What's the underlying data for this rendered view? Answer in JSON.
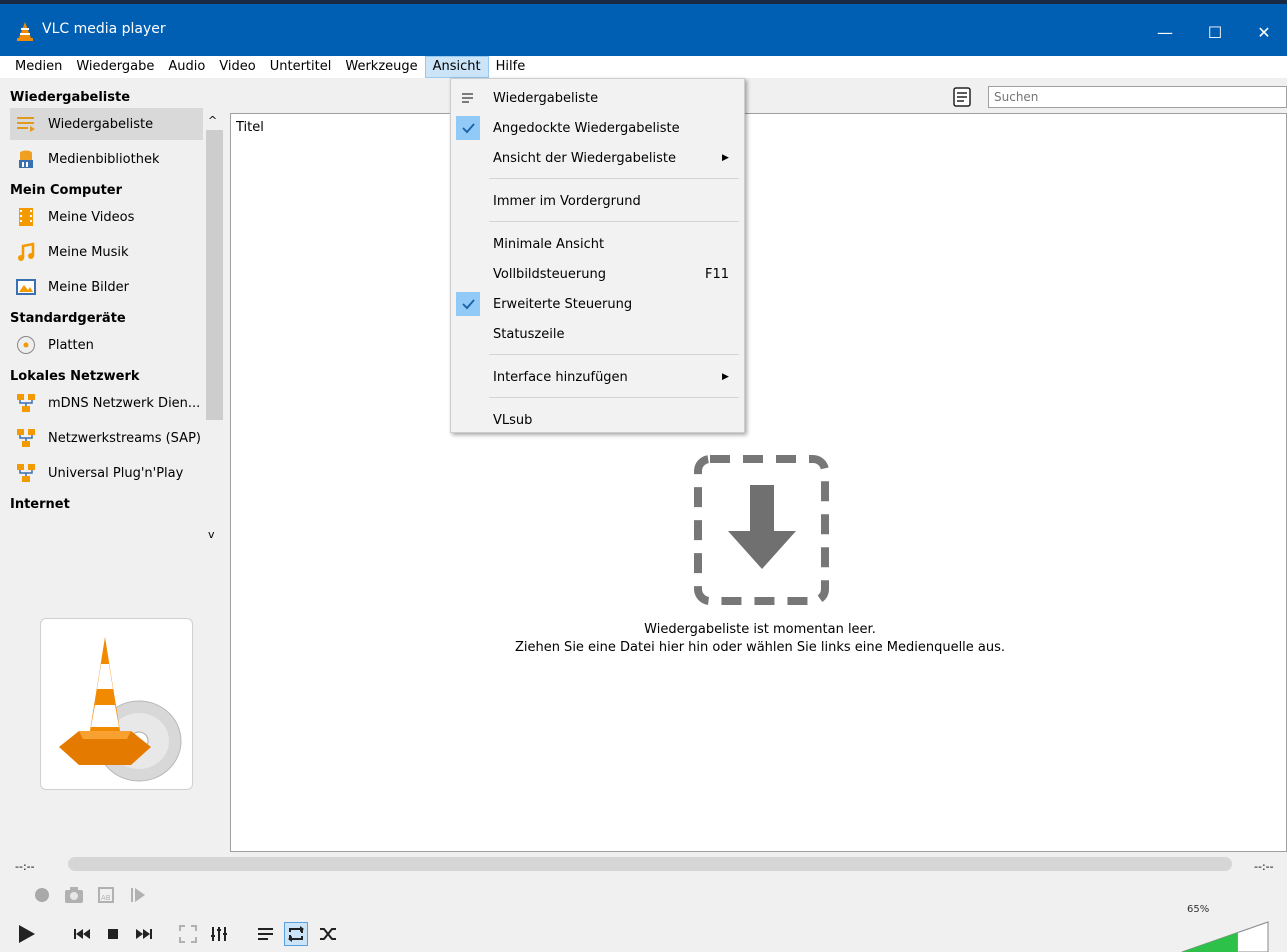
{
  "window": {
    "title": "VLC media player",
    "controls": {
      "minimize": "—",
      "maximize": "☐",
      "close": "✕"
    }
  },
  "menubar": [
    "Medien",
    "Wiedergabe",
    "Audio",
    "Video",
    "Untertitel",
    "Werkzeuge",
    "Ansicht",
    "Hilfe"
  ],
  "sidebar": {
    "sections": [
      {
        "heading": "Wiedergabeliste",
        "items": [
          {
            "label": "Wiedergabeliste",
            "icon": "playlist-icon",
            "selected": true
          },
          {
            "label": "Medienbibliothek",
            "icon": "media-library-icon"
          }
        ]
      },
      {
        "heading": "Mein Computer",
        "items": [
          {
            "label": "Meine Videos",
            "icon": "video-film-icon"
          },
          {
            "label": "Meine Musik",
            "icon": "music-note-icon"
          },
          {
            "label": "Meine Bilder",
            "icon": "picture-icon"
          }
        ]
      },
      {
        "heading": "Standardgeräte",
        "items": [
          {
            "label": "Platten",
            "icon": "disc-icon"
          }
        ]
      },
      {
        "heading": "Lokales Netzwerk",
        "items": [
          {
            "label": "mDNS Netzwerk Dien...",
            "icon": "network-icon"
          },
          {
            "label": "Netzwerkstreams (SAP)",
            "icon": "network-icon"
          },
          {
            "label": "Universal Plug'n'Play",
            "icon": "network-icon"
          }
        ]
      },
      {
        "heading": "Internet",
        "items": []
      }
    ]
  },
  "playlist": {
    "search_placeholder": "Suchen",
    "column_title": "Titel",
    "empty_line1": "Wiedergabeliste ist momentan leer.",
    "empty_line2": "Ziehen Sie eine Datei hier hin oder wählen Sie links eine Medienquelle aus."
  },
  "dropdown": {
    "groups": [
      [
        {
          "label": "Wiedergabeliste",
          "icon": "playlist-icon"
        },
        {
          "label": "Angedockte Wiedergabeliste",
          "checked": true
        },
        {
          "label": "Ansicht der Wiedergabeliste",
          "submenu": true
        }
      ],
      [
        {
          "label": "Immer im Vordergrund"
        }
      ],
      [
        {
          "label": "Minimale Ansicht"
        },
        {
          "label": "Vollbildsteuerung",
          "shortcut": "F11"
        },
        {
          "label": "Erweiterte Steuerung",
          "checked": true
        },
        {
          "label": "Statuszeile"
        }
      ],
      [
        {
          "label": "Interface hinzufügen",
          "submenu": true
        }
      ],
      [
        {
          "label": "VLsub"
        }
      ]
    ]
  },
  "player": {
    "time_elapsed": "--:--",
    "time_total": "--:--",
    "volume_percent": 65,
    "volume_label": "65%",
    "loop_checked": true
  },
  "colors": {
    "titlebar": "#005fb3",
    "selection": "#cce4f7",
    "check_highlight": "#91c9f7",
    "volume_fill": "#2ec14a"
  }
}
